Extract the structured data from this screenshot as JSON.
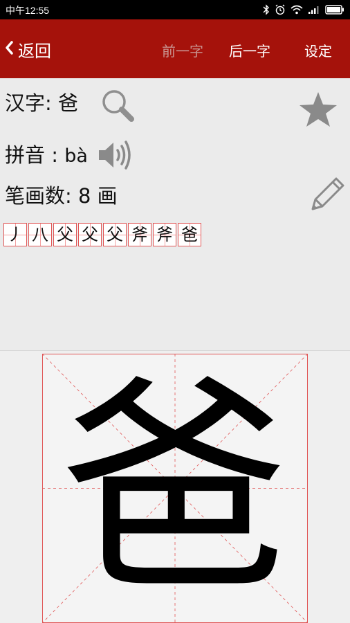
{
  "status_bar": {
    "time": "中午12:55",
    "icons": [
      "bluetooth-icon",
      "alarm-icon",
      "wifi-icon",
      "signal-icon",
      "battery-icon"
    ]
  },
  "header": {
    "back_label": "返回",
    "prev_label": "前一字",
    "next_label": "后一字",
    "settings_label": "设定",
    "background_color": "#a5120b",
    "disabled_color": "#c8938f"
  },
  "character": {
    "hanzi_label": "汉字:",
    "hanzi": "爸",
    "pinyin_label": "拼音 :",
    "pinyin": "bà",
    "strokes_label": "笔画数:",
    "stroke_count": "8",
    "strokes_unit": "画"
  },
  "stroke_steps": [
    "丿",
    "八",
    "父",
    "父",
    "父",
    "斧",
    "斧",
    "爸"
  ],
  "grid_color": "#e05555"
}
